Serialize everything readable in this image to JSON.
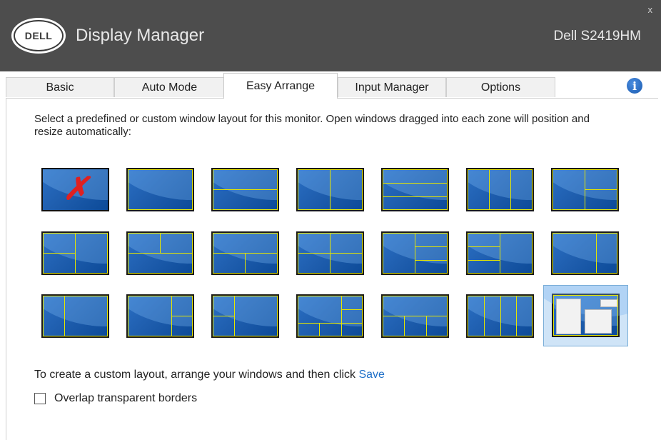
{
  "titlebar": {
    "logo_text": "DELL",
    "app_title": "Display Manager",
    "monitor_name": "Dell S2419HM",
    "close_label": "x"
  },
  "tabs": [
    {
      "label": "Basic",
      "active": false
    },
    {
      "label": "Auto Mode",
      "active": false
    },
    {
      "label": "Easy Arrange",
      "active": true
    },
    {
      "label": "Input Manager",
      "active": false
    },
    {
      "label": "Options",
      "active": false
    }
  ],
  "info_icon_label": "i",
  "description": "Select a predefined or custom window layout for this monitor.  Open windows dragged into each zone will position and resize automatically:",
  "layouts_selected": 20,
  "footer": {
    "custom_text": "To create a custom layout, arrange your windows and then click",
    "save_label": "Save",
    "overlap_label": "Overlap transparent borders",
    "overlap_checked": false
  }
}
